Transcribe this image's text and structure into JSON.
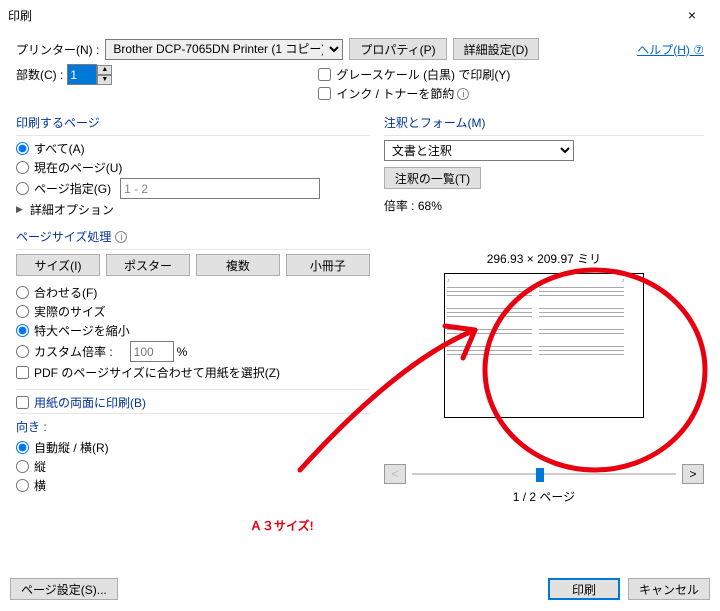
{
  "title": "印刷",
  "close": "×",
  "printer_label": "プリンター(N) :",
  "printer_value": "Brother DCP-7065DN Printer (1 コピー)",
  "properties_btn": "プロパティ(P)",
  "advanced_btn": "詳細設定(D)",
  "help": "ヘルプ(H)",
  "copies_label": "部数(C) :",
  "copies_value": "1",
  "grayscale": "グレースケール (白黒) で印刷(Y)",
  "ink_save": "インク / トナーを節約",
  "print_pages": "印刷するページ",
  "opt_all": "すべて(A)",
  "opt_current": "現在のページ(U)",
  "opt_range": "ページ指定(G)",
  "range_value": "1 - 2",
  "adv_options": "詳細オプション",
  "page_size": "ページサイズ処理",
  "tab_size": "サイズ(I)",
  "tab_poster": "ポスター",
  "tab_multi": "複数",
  "tab_booklet": "小冊子",
  "fit": "合わせる(F)",
  "actual": "実際のサイズ",
  "shrink": "特大ページを縮小",
  "custom_scale": "カスタム倍率 :",
  "custom_scale_val": "100",
  "custom_scale_pct": "%",
  "choose_paper": "PDF のページサイズに合わせて用紙を選択(Z)",
  "duplex": "用紙の両面に印刷(B)",
  "orient_label": "向き :",
  "orient_auto": "自動縦 / 横(R)",
  "orient_port": "縦",
  "orient_land": "横",
  "comments_forms": "注釈とフォーム(M)",
  "doc_comments": "文書と注釈",
  "comments_list": "注釈の一覧(T)",
  "scale_label": "倍率 : 68%",
  "dim": "296.93 × 209.97 ミリ",
  "page_of": "1 / 2 ページ",
  "page_setup": "ページ設定(S)...",
  "print_btn": "印刷",
  "cancel_btn": "キャンセル",
  "arrow_btn": ">",
  "next_btn": ">",
  "prev_btn": "<",
  "anno_text": "Ａ３サイズ!"
}
